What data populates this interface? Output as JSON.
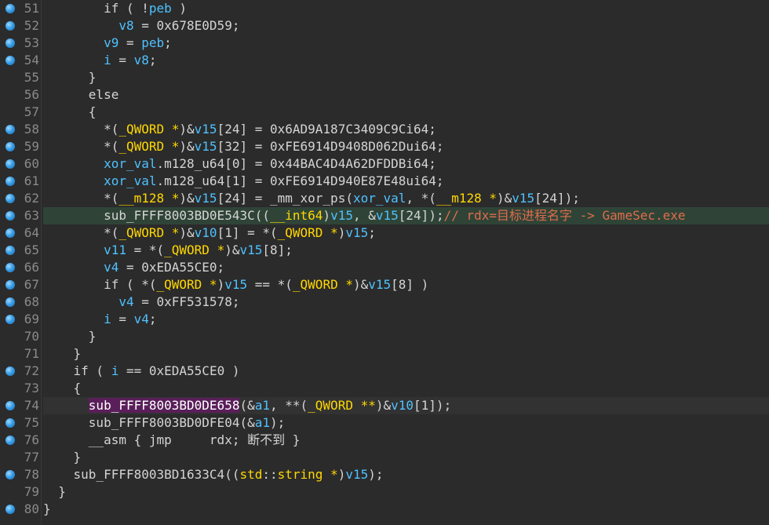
{
  "editor": {
    "lines": [
      {
        "n": "51",
        "bp": true,
        "hl": "",
        "t": [
          [
            "plain",
            "        if ( !"
          ],
          [
            "var",
            "peb"
          ],
          [
            "plain",
            " )"
          ]
        ]
      },
      {
        "n": "52",
        "bp": true,
        "hl": "",
        "t": [
          [
            "plain",
            "          "
          ],
          [
            "var",
            "v8"
          ],
          [
            "plain",
            " = 0x678E0D59;"
          ]
        ]
      },
      {
        "n": "53",
        "bp": true,
        "hl": "",
        "t": [
          [
            "plain",
            "        "
          ],
          [
            "var",
            "v9"
          ],
          [
            "plain",
            " = "
          ],
          [
            "var",
            "peb"
          ],
          [
            "plain",
            ";"
          ]
        ]
      },
      {
        "n": "54",
        "bp": true,
        "hl": "",
        "t": [
          [
            "plain",
            "        "
          ],
          [
            "var",
            "i"
          ],
          [
            "plain",
            " = "
          ],
          [
            "var",
            "v8"
          ],
          [
            "plain",
            ";"
          ]
        ]
      },
      {
        "n": "55",
        "bp": false,
        "hl": "",
        "t": [
          [
            "plain",
            "      }"
          ]
        ]
      },
      {
        "n": "56",
        "bp": false,
        "hl": "",
        "t": [
          [
            "plain",
            "      else"
          ]
        ]
      },
      {
        "n": "57",
        "bp": false,
        "hl": "",
        "t": [
          [
            "plain",
            "      {"
          ]
        ]
      },
      {
        "n": "58",
        "bp": true,
        "hl": "",
        "t": [
          [
            "plain",
            "        *("
          ],
          [
            "typ",
            "_QWORD *"
          ],
          [
            "plain",
            ")&"
          ],
          [
            "var",
            "v15"
          ],
          [
            "plain",
            "[24] = 0x6AD9A187C3409C9Ci64;"
          ]
        ]
      },
      {
        "n": "59",
        "bp": true,
        "hl": "",
        "t": [
          [
            "plain",
            "        *("
          ],
          [
            "typ",
            "_QWORD *"
          ],
          [
            "plain",
            ")&"
          ],
          [
            "var",
            "v15"
          ],
          [
            "plain",
            "[32] = 0xFE6914D9408D062Dui64;"
          ]
        ]
      },
      {
        "n": "60",
        "bp": true,
        "hl": "",
        "t": [
          [
            "plain",
            "        "
          ],
          [
            "var",
            "xor_val"
          ],
          [
            "plain",
            ".m128_u64[0] = 0x44BAC4D4A62DFDDBi64;"
          ]
        ]
      },
      {
        "n": "61",
        "bp": true,
        "hl": "",
        "t": [
          [
            "plain",
            "        "
          ],
          [
            "var",
            "xor_val"
          ],
          [
            "plain",
            ".m128_u64[1] = 0xFE6914D940E87E48ui64;"
          ]
        ]
      },
      {
        "n": "62",
        "bp": true,
        "hl": "",
        "t": [
          [
            "plain",
            "        *("
          ],
          [
            "typ",
            "__m128 *"
          ],
          [
            "plain",
            ")&"
          ],
          [
            "var",
            "v15"
          ],
          [
            "plain",
            "[24] = _mm_xor_ps("
          ],
          [
            "var",
            "xor_val"
          ],
          [
            "plain",
            ", *("
          ],
          [
            "typ",
            "__m128 *"
          ],
          [
            "plain",
            ")&"
          ],
          [
            "var",
            "v15"
          ],
          [
            "plain",
            "[24]);"
          ]
        ]
      },
      {
        "n": "63",
        "bp": true,
        "hl": "hl",
        "t": [
          [
            "plain",
            "        sub_FFFF8003BD0E543C(("
          ],
          [
            "typ",
            "__int64"
          ],
          [
            "plain",
            ")"
          ],
          [
            "var",
            "v15"
          ],
          [
            "plain",
            ", &"
          ],
          [
            "var",
            "v15"
          ],
          [
            "plain",
            "[24]);"
          ],
          [
            "cmt",
            "// rdx=目标进程名字 -> GameSec.exe"
          ]
        ]
      },
      {
        "n": "64",
        "bp": true,
        "hl": "",
        "t": [
          [
            "plain",
            "        *("
          ],
          [
            "typ",
            "_QWORD *"
          ],
          [
            "plain",
            ")&"
          ],
          [
            "var",
            "v10"
          ],
          [
            "plain",
            "[1] = *("
          ],
          [
            "typ",
            "_QWORD *"
          ],
          [
            "plain",
            ")"
          ],
          [
            "var",
            "v15"
          ],
          [
            "plain",
            ";"
          ]
        ]
      },
      {
        "n": "65",
        "bp": true,
        "hl": "",
        "t": [
          [
            "plain",
            "        "
          ],
          [
            "var",
            "v11"
          ],
          [
            "plain",
            " = *("
          ],
          [
            "typ",
            "_QWORD *"
          ],
          [
            "plain",
            ")&"
          ],
          [
            "var",
            "v15"
          ],
          [
            "plain",
            "[8];"
          ]
        ]
      },
      {
        "n": "66",
        "bp": true,
        "hl": "",
        "t": [
          [
            "plain",
            "        "
          ],
          [
            "var",
            "v4"
          ],
          [
            "plain",
            " = 0xEDA55CE0;"
          ]
        ]
      },
      {
        "n": "67",
        "bp": true,
        "hl": "",
        "t": [
          [
            "plain",
            "        if ( *("
          ],
          [
            "typ",
            "_QWORD *"
          ],
          [
            "plain",
            ")"
          ],
          [
            "var",
            "v15"
          ],
          [
            "plain",
            " == *("
          ],
          [
            "typ",
            "_QWORD *"
          ],
          [
            "plain",
            ")&"
          ],
          [
            "var",
            "v15"
          ],
          [
            "plain",
            "[8] )"
          ]
        ]
      },
      {
        "n": "68",
        "bp": true,
        "hl": "",
        "t": [
          [
            "plain",
            "          "
          ],
          [
            "var",
            "v4"
          ],
          [
            "plain",
            " = 0xFF531578;"
          ]
        ]
      },
      {
        "n": "69",
        "bp": true,
        "hl": "",
        "t": [
          [
            "plain",
            "        "
          ],
          [
            "var",
            "i"
          ],
          [
            "plain",
            " = "
          ],
          [
            "var",
            "v4"
          ],
          [
            "plain",
            ";"
          ]
        ]
      },
      {
        "n": "70",
        "bp": false,
        "hl": "",
        "t": [
          [
            "plain",
            "      }"
          ]
        ]
      },
      {
        "n": "71",
        "bp": false,
        "hl": "",
        "t": [
          [
            "plain",
            "    }"
          ]
        ]
      },
      {
        "n": "72",
        "bp": true,
        "hl": "",
        "t": [
          [
            "plain",
            "    if ( "
          ],
          [
            "var",
            "i"
          ],
          [
            "plain",
            " == 0xEDA55CE0 )"
          ]
        ]
      },
      {
        "n": "73",
        "bp": false,
        "hl": "",
        "t": [
          [
            "plain",
            "    {"
          ]
        ]
      },
      {
        "n": "74",
        "bp": true,
        "hl": "hl74",
        "t": [
          [
            "plain",
            "      "
          ],
          [
            "fnhl",
            "sub_FFFF8003BD0DE658"
          ],
          [
            "plain",
            "(&"
          ],
          [
            "var",
            "a1"
          ],
          [
            "plain",
            ", **("
          ],
          [
            "typ",
            "_QWORD **"
          ],
          [
            "plain",
            ")&"
          ],
          [
            "var",
            "v10"
          ],
          [
            "plain",
            "[1]);"
          ]
        ]
      },
      {
        "n": "75",
        "bp": true,
        "hl": "",
        "t": [
          [
            "plain",
            "      sub_FFFF8003BD0DFE04(&"
          ],
          [
            "var",
            "a1"
          ],
          [
            "plain",
            ");"
          ]
        ]
      },
      {
        "n": "76",
        "bp": true,
        "hl": "",
        "t": [
          [
            "plain",
            "      __asm { jmp     rdx; 断不到 }"
          ]
        ]
      },
      {
        "n": "77",
        "bp": false,
        "hl": "",
        "t": [
          [
            "plain",
            "    }"
          ]
        ]
      },
      {
        "n": "78",
        "bp": true,
        "hl": "",
        "t": [
          [
            "plain",
            "    sub_FFFF8003BD1633C4(("
          ],
          [
            "typ",
            "std"
          ],
          [
            "plain",
            "::"
          ],
          [
            "typ",
            "string *"
          ],
          [
            "plain",
            ")"
          ],
          [
            "var",
            "v15"
          ],
          [
            "plain",
            ");"
          ]
        ]
      },
      {
        "n": "79",
        "bp": false,
        "hl": "",
        "t": [
          [
            "plain",
            "  }"
          ]
        ]
      },
      {
        "n": "80",
        "bp": true,
        "hl": "",
        "t": [
          [
            "plain",
            "}"
          ]
        ]
      }
    ]
  }
}
